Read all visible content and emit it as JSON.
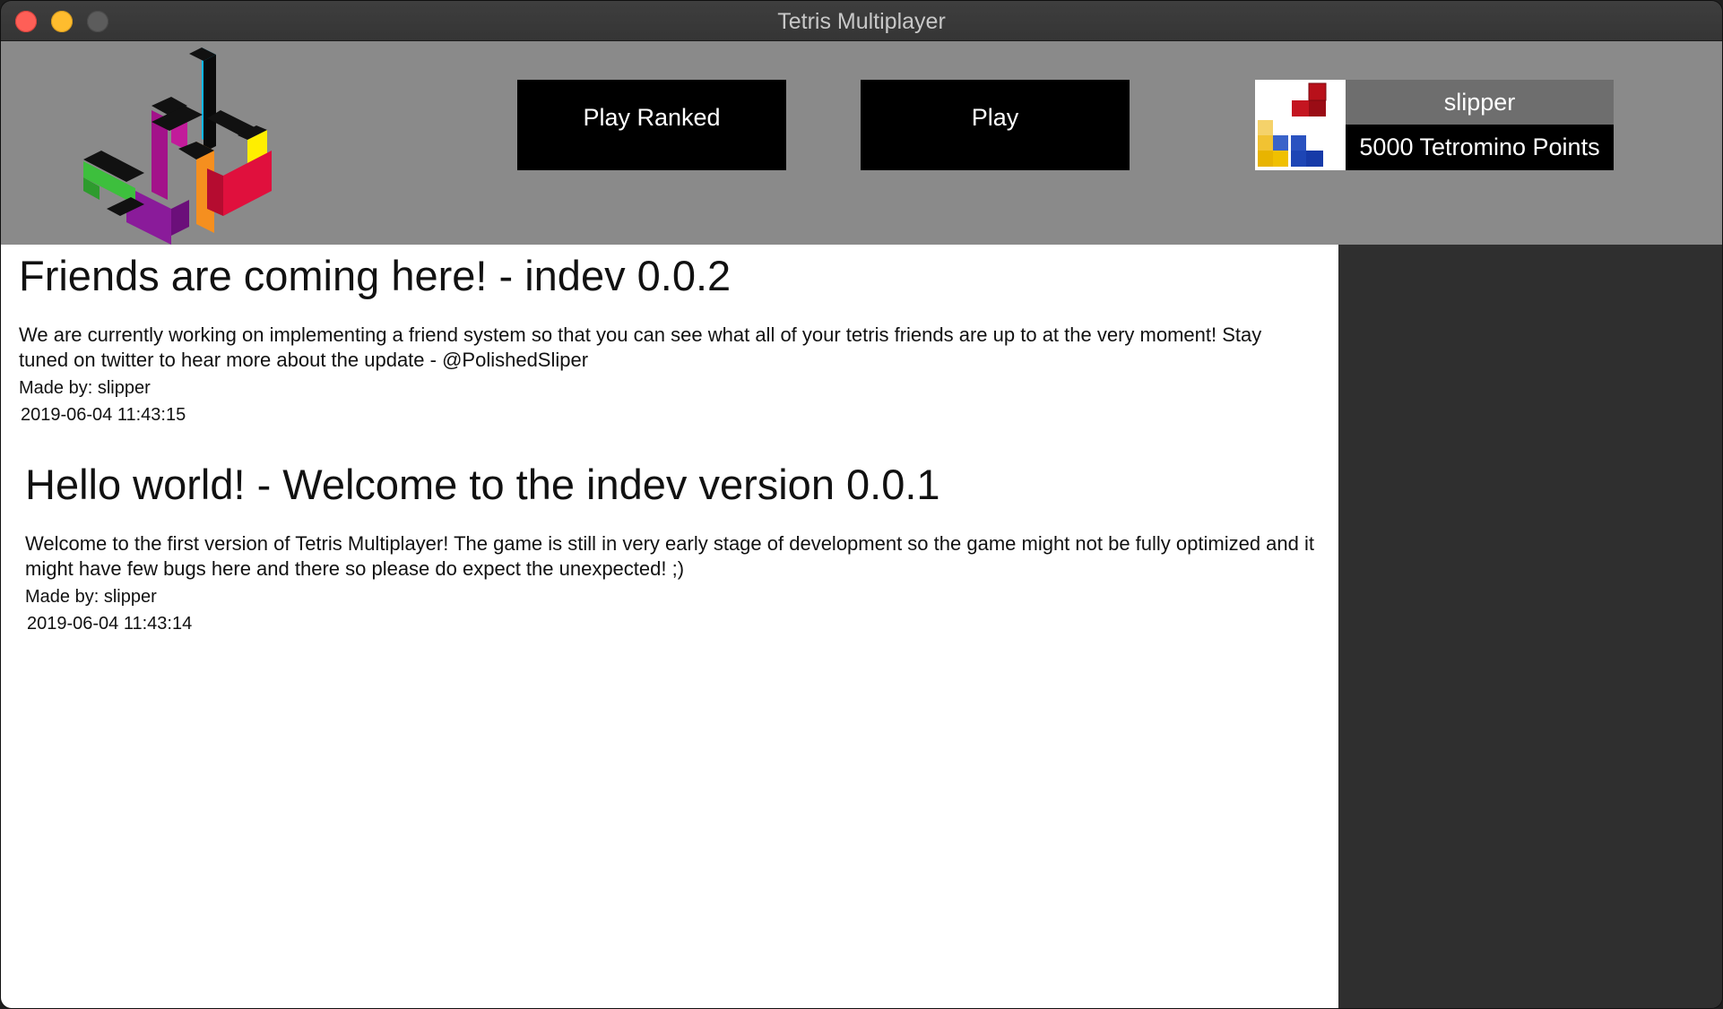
{
  "window": {
    "title": "Tetris Multiplayer"
  },
  "header": {
    "play_ranked_label": "Play Ranked",
    "play_label": "Play"
  },
  "profile": {
    "username": "slipper",
    "points": "5000 Tetromino Points"
  },
  "posts": [
    {
      "title": "Friends are coming here! - indev 0.0.2",
      "body": "We are currently working on implementing a friend system so that you can see what all of your tetris friends are up to at the very moment! Stay tuned on twitter to hear more about the update - @PolishedSliper",
      "author": "Made by: slipper",
      "date": "2019-06-04 11:43:15"
    },
    {
      "title": "Hello world! - Welcome to the indev version 0.0.1",
      "body": "Welcome to the first version of Tetris Multiplayer! The game is still in very early stage of development so the game might not be fully optimized and it might have few bugs here and there so please do expect the unexpected! ;)",
      "author": "Made by: slipper",
      "date": "2019-06-04 11:43:14"
    }
  ]
}
